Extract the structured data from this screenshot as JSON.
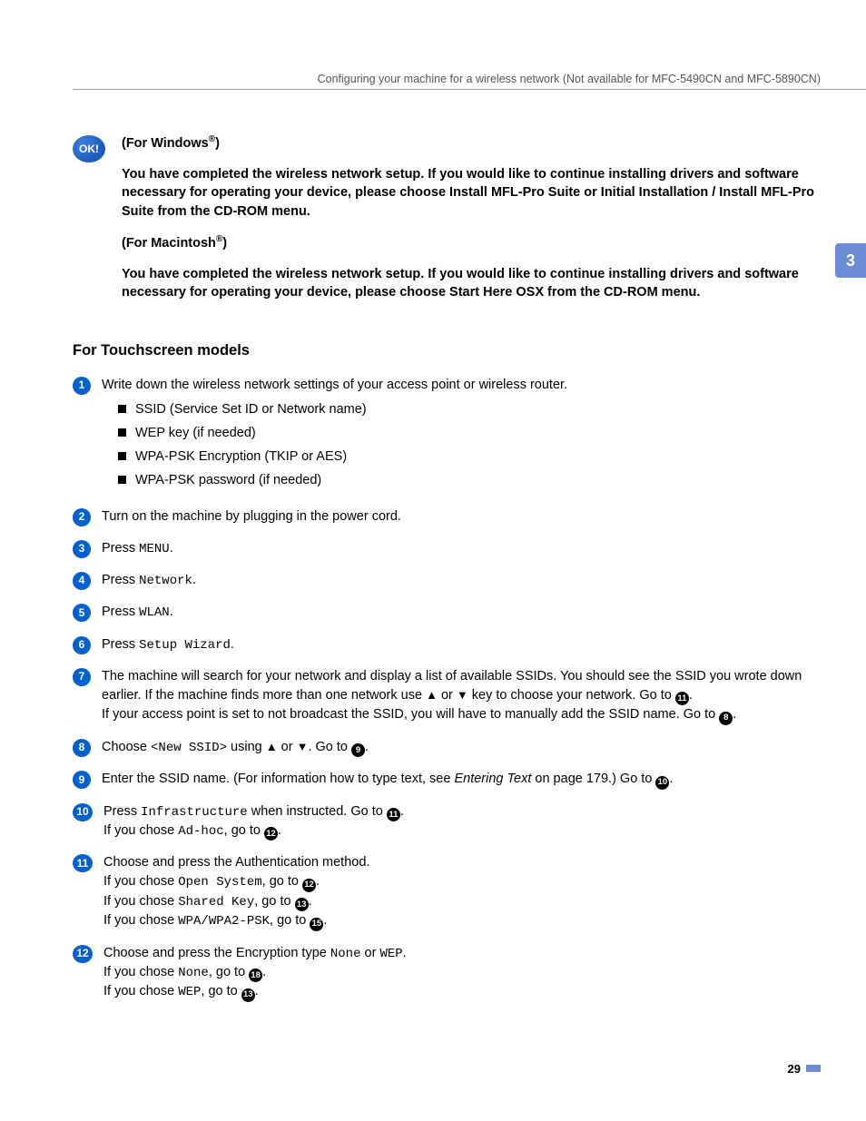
{
  "header": {
    "running_title": "Configuring your machine for a wireless network (Not available for MFC-5490CN and MFC-5890CN)"
  },
  "chapter_tab": "3",
  "ok_badge": "OK!",
  "ok_block": {
    "win_heading_prefix": "(For Windows",
    "win_heading_suffix": ")",
    "win_body": "You have completed the wireless network setup. If you would like to continue installing drivers and software necessary for operating your device, please choose Install MFL-Pro Suite or Initial Installation / Install MFL-Pro Suite from the CD-ROM menu.",
    "mac_heading_prefix": "(For Macintosh",
    "mac_heading_suffix": ")",
    "mac_body": "You have completed the wireless network setup. If you would like to continue installing drivers and software necessary for operating your device, please choose Start Here OSX from the CD-ROM menu."
  },
  "section_heading": "For Touchscreen models",
  "steps": {
    "s1": {
      "num": "1",
      "text": "Write down the wireless network settings of your access point or wireless router.",
      "bullets": [
        "SSID (Service Set ID or Network name)",
        "WEP key (if needed)",
        "WPA-PSK Encryption (TKIP or AES)",
        "WPA-PSK password (if needed)"
      ]
    },
    "s2": {
      "num": "2",
      "text": "Turn on the machine by plugging in the power cord."
    },
    "s3": {
      "num": "3",
      "prefix": "Press ",
      "code": "MENU",
      "suffix": "."
    },
    "s4": {
      "num": "4",
      "prefix": "Press ",
      "code": "Network",
      "suffix": "."
    },
    "s5": {
      "num": "5",
      "prefix": "Press ",
      "code": "WLAN",
      "suffix": "."
    },
    "s6": {
      "num": "6",
      "prefix": "Press ",
      "code": "Setup Wizard",
      "suffix": "."
    },
    "s7": {
      "num": "7",
      "line1a": "The machine will search for your network and display a list of available SSIDs. You should see the SSID you wrote down earlier. If the machine finds more than one network use ",
      "up": "▲",
      "line1b": " or ",
      "down": "▼",
      "line1c": " key to choose your network. Go to ",
      "ref1": "11",
      "line1d": ".",
      "line2a": "If your access point is set to not broadcast the SSID, you will have to manually add the SSID name. Go to ",
      "ref2": "8",
      "line2b": "."
    },
    "s8": {
      "num": "8",
      "a": "Choose ",
      "code": "<New SSID>",
      "b": " using ",
      "up": "▲",
      "c": " or ",
      "down": "▼",
      "d": ". Go to ",
      "ref": "9",
      "e": "."
    },
    "s9": {
      "num": "9",
      "a": "Enter the SSID name. (For information how to type text, see ",
      "italic": "Entering Text",
      "b": " on page 179.) Go to ",
      "ref": "10",
      "c": "."
    },
    "s10": {
      "num": "10",
      "a": "Press ",
      "code1": "Infrastructure",
      "b": " when instructed. Go to ",
      "ref1": "11",
      "c": ".",
      "d": "If you chose ",
      "code2": "Ad-hoc",
      "e": ", go to ",
      "ref2": "12",
      "f": "."
    },
    "s11": {
      "num": "11",
      "intro": "Choose and press the Authentication method.",
      "l1a": "If you chose ",
      "c1": "Open System",
      "l1b": ", go to ",
      "r1": "12",
      "l1c": ".",
      "l2a": "If you chose ",
      "c2": "Shared Key",
      "l2b": ", go to ",
      "r2": "13",
      "l2c": ".",
      "l3a": "If you chose ",
      "c3": "WPA/WPA2-PSK",
      "l3b": ", go to ",
      "r3": "15",
      "l3c": "."
    },
    "s12": {
      "num": "12",
      "introA": "Choose and press the Encryption type ",
      "codeA": "None",
      "introB": " or ",
      "codeB": "WEP",
      "introC": ".",
      "l1a": "If you chose ",
      "c1": "None",
      "l1b": ", go to ",
      "r1": "18",
      "l1c": ".",
      "l2a": "If you chose ",
      "c2": "WEP",
      "l2b": ", go to ",
      "r2": "13",
      "l2c": "."
    }
  },
  "reg_symbol": "®",
  "page_number": "29"
}
